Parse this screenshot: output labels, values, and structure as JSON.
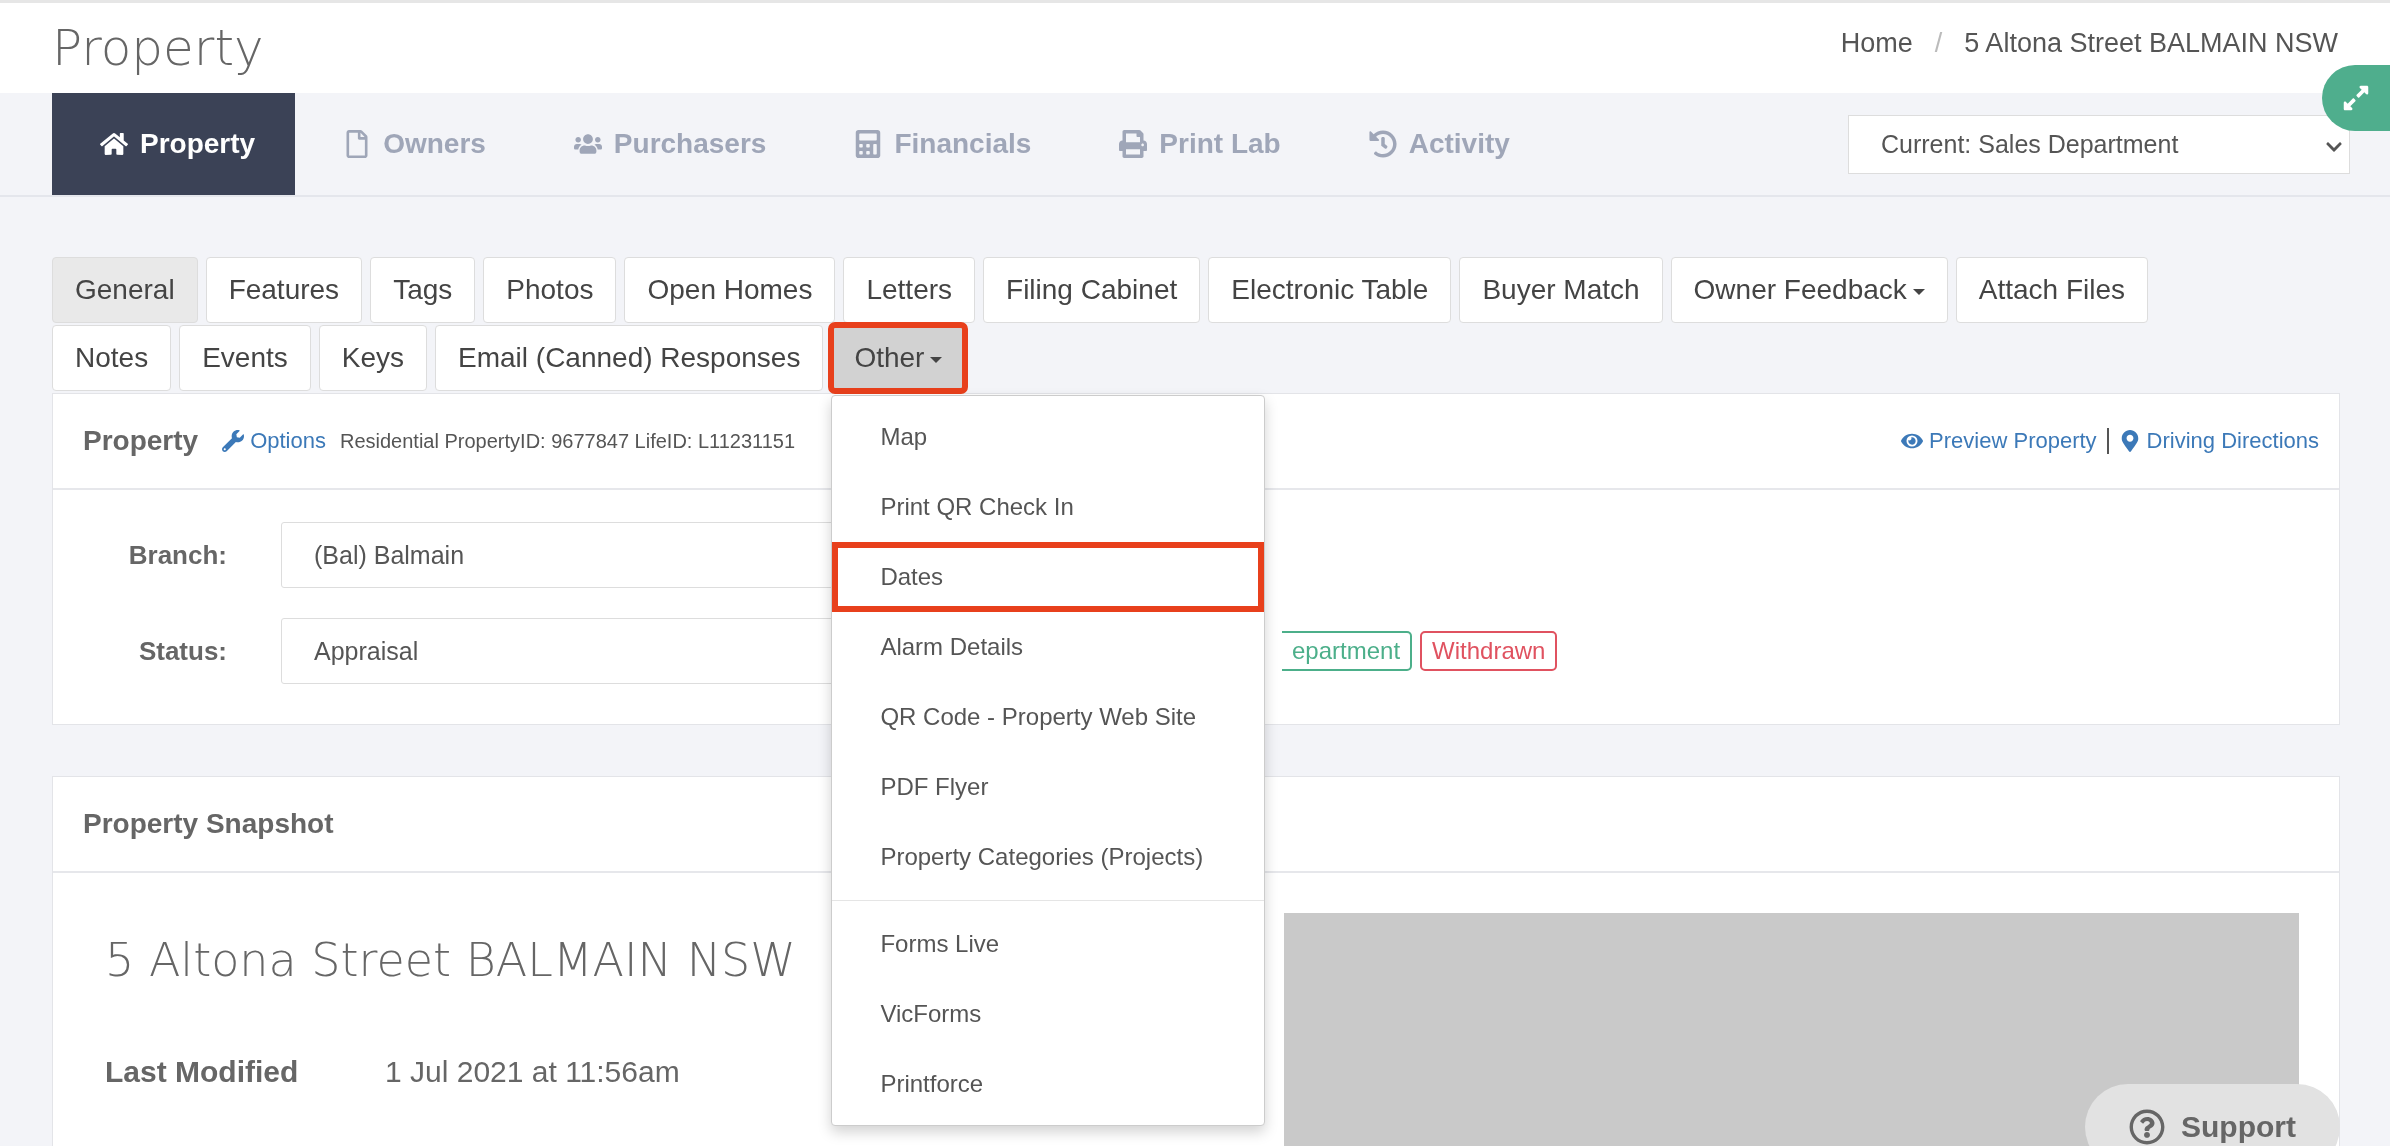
{
  "page_title": "Property",
  "breadcrumb": [
    "Home",
    "5 Altona Street BALMAIN NSW"
  ],
  "breadcrumb_separator": "/",
  "nav_tabs": [
    {
      "label": "Property",
      "selected": true
    },
    {
      "label": "Owners",
      "selected": false
    },
    {
      "label": "Purchasers",
      "selected": false
    },
    {
      "label": "Financials",
      "selected": false
    },
    {
      "label": "Print Lab",
      "selected": false
    },
    {
      "label": "Activity",
      "selected": false
    }
  ],
  "department_select": {
    "value": "Current: Sales Department"
  },
  "sub_tab_rows": [
    [
      {
        "label": "General",
        "selected": true,
        "caret": false,
        "highlighted": false
      },
      {
        "label": "Features",
        "selected": false,
        "caret": false,
        "highlighted": false
      },
      {
        "label": "Tags",
        "selected": false,
        "caret": false,
        "highlighted": false
      },
      {
        "label": "Photos",
        "selected": false,
        "caret": false,
        "highlighted": false
      },
      {
        "label": "Open Homes",
        "selected": false,
        "caret": false,
        "highlighted": false
      },
      {
        "label": "Letters",
        "selected": false,
        "caret": false,
        "highlighted": false
      },
      {
        "label": "Filing Cabinet",
        "selected": false,
        "caret": false,
        "highlighted": false
      },
      {
        "label": "Electronic Table",
        "selected": false,
        "caret": false,
        "highlighted": false
      },
      {
        "label": "Buyer Match",
        "selected": false,
        "caret": false,
        "highlighted": false
      },
      {
        "label": "Owner Feedback",
        "selected": false,
        "caret": true,
        "highlighted": false
      },
      {
        "label": "Attach Files",
        "selected": false,
        "caret": false,
        "highlighted": false
      }
    ],
    [
      {
        "label": "Notes",
        "selected": false,
        "caret": false,
        "highlighted": false
      },
      {
        "label": "Events",
        "selected": false,
        "caret": false,
        "highlighted": false
      },
      {
        "label": "Keys",
        "selected": false,
        "caret": false,
        "highlighted": false
      },
      {
        "label": "Email (Canned) Responses",
        "selected": false,
        "caret": false,
        "highlighted": false
      },
      {
        "label": "Other",
        "selected": false,
        "caret": true,
        "highlighted": true,
        "open": true
      }
    ]
  ],
  "dropdown_menu": {
    "sections": [
      [
        {
          "label": "Map",
          "highlighted": false
        },
        {
          "label": "Print QR Check In",
          "highlighted": false
        },
        {
          "label": "Dates",
          "highlighted": true
        },
        {
          "label": "Alarm Details",
          "highlighted": false
        },
        {
          "label": "QR Code - Property Web Site",
          "highlighted": false
        },
        {
          "label": "PDF Flyer",
          "highlighted": false
        },
        {
          "label": "Property Categories (Projects)",
          "highlighted": false
        }
      ],
      [
        {
          "label": "Forms Live",
          "highlighted": false
        },
        {
          "label": "VicForms",
          "highlighted": false
        },
        {
          "label": "Printforce",
          "highlighted": false
        }
      ]
    ]
  },
  "property_panel": {
    "title": "Property",
    "options_link": "Options",
    "ids": "Residential PropertyID: 9677847 LifeID: L11231151",
    "links": [
      {
        "label": "Preview Property"
      },
      {
        "label": "Driving Directions"
      }
    ],
    "fields": [
      {
        "label": "Branch:",
        "value": "(Bal) Balmain"
      },
      {
        "label": "Status:",
        "value": "Appraisal"
      }
    ],
    "badges": [
      {
        "label": "epartment",
        "color": "#4caf8a"
      },
      {
        "label": "Withdrawn",
        "color": "#e05260"
      }
    ]
  },
  "snapshot_panel": {
    "title": "Property Snapshot",
    "address": "5 Altona Street BALMAIN NSW",
    "details": [
      {
        "label": "Last Modified",
        "value": "1 Jul 2021 at 11:56am"
      }
    ]
  },
  "support_button": {
    "label": "Support"
  }
}
